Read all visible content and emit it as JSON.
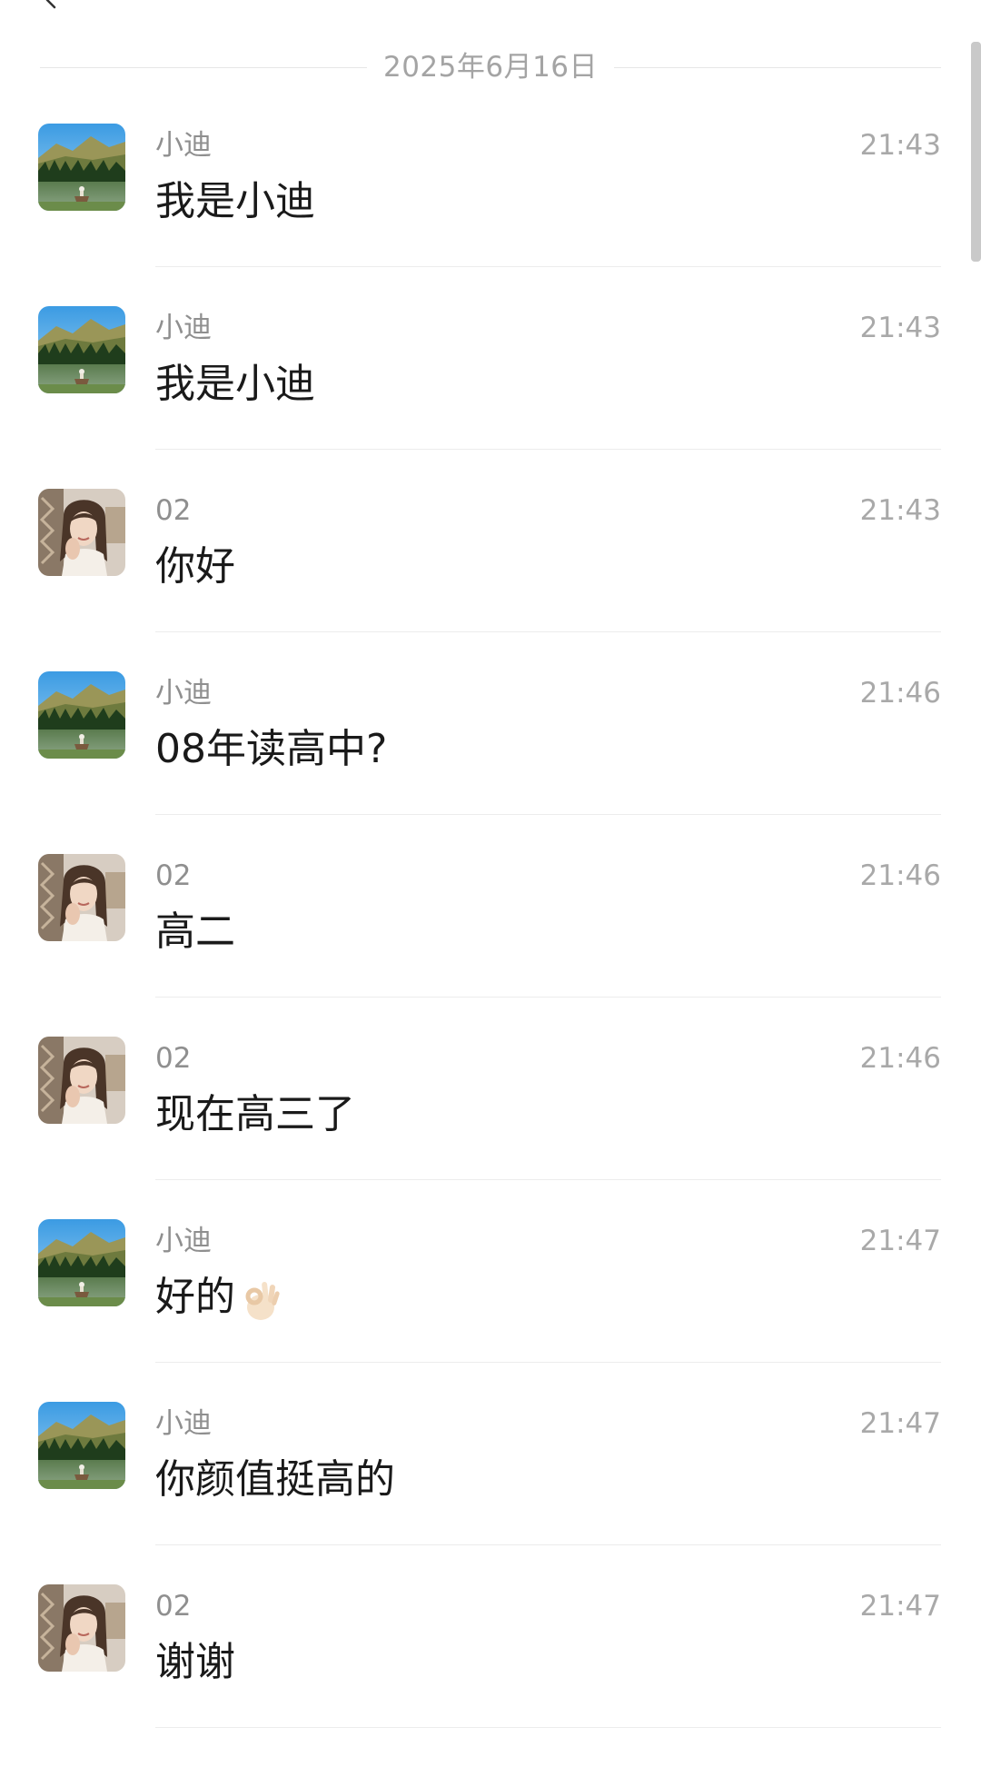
{
  "header": {
    "back_icon": "back-arrow-icon"
  },
  "date_separator": "2025年6月16日",
  "messages": [
    {
      "sender": "小迪",
      "avatar": "landscape-avatar",
      "time": "21:43",
      "text": "我是小迪"
    },
    {
      "sender": "小迪",
      "avatar": "landscape-avatar",
      "time": "21:43",
      "text": "我是小迪"
    },
    {
      "sender": "02",
      "avatar": "girl-avatar",
      "time": "21:43",
      "text": "你好"
    },
    {
      "sender": "小迪",
      "avatar": "landscape-avatar",
      "time": "21:46",
      "text": "08年读高中?"
    },
    {
      "sender": "02",
      "avatar": "girl-avatar",
      "time": "21:46",
      "text": "高二"
    },
    {
      "sender": "02",
      "avatar": "girl-avatar",
      "time": "21:46",
      "text": "现在高三了"
    },
    {
      "sender": "小迪",
      "avatar": "landscape-avatar",
      "time": "21:47",
      "text": "好的",
      "emoji": "ok-hand-emoji"
    },
    {
      "sender": "小迪",
      "avatar": "landscape-avatar",
      "time": "21:47",
      "text": "你颜值挺高的"
    },
    {
      "sender": "02",
      "avatar": "girl-avatar",
      "time": "21:47",
      "text": "谢谢"
    }
  ]
}
